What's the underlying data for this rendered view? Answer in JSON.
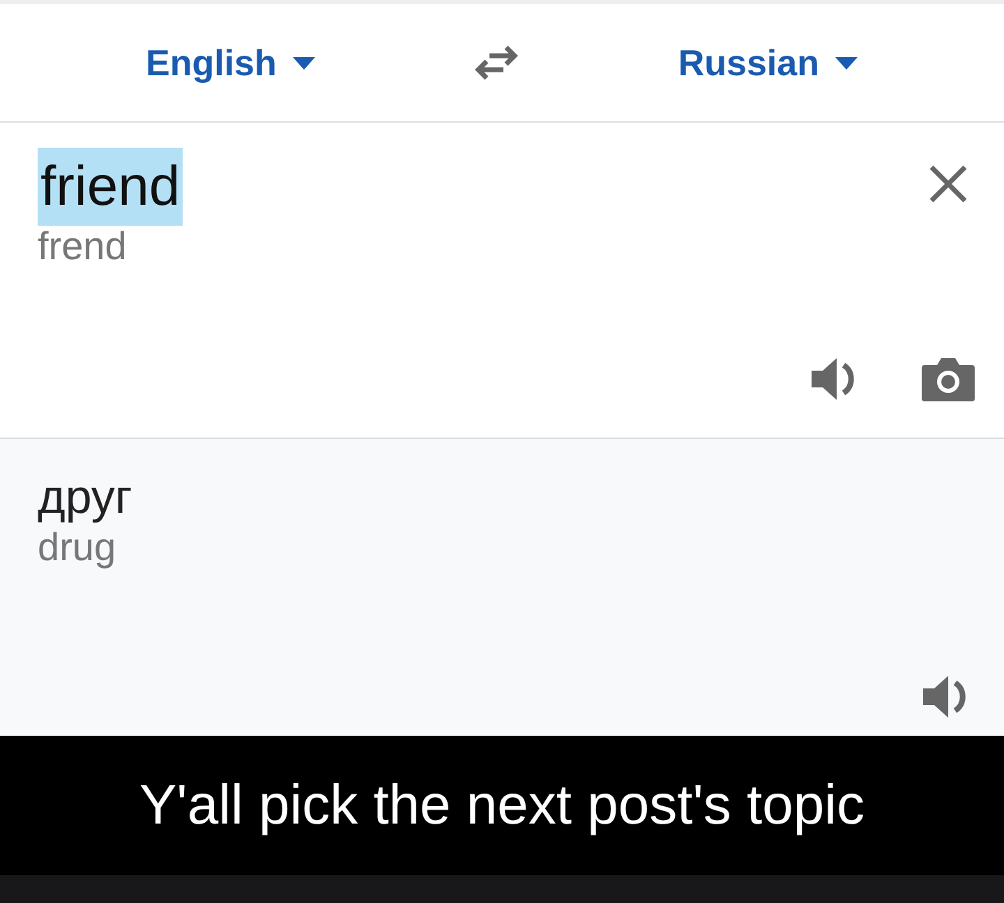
{
  "languages": {
    "source": "English",
    "target": "Russian"
  },
  "source": {
    "text": "friend",
    "selected": true,
    "transliteration": "frend"
  },
  "result": {
    "text": "друг",
    "transliteration": "drug"
  },
  "caption": "Y'all pick the next post's topic"
}
